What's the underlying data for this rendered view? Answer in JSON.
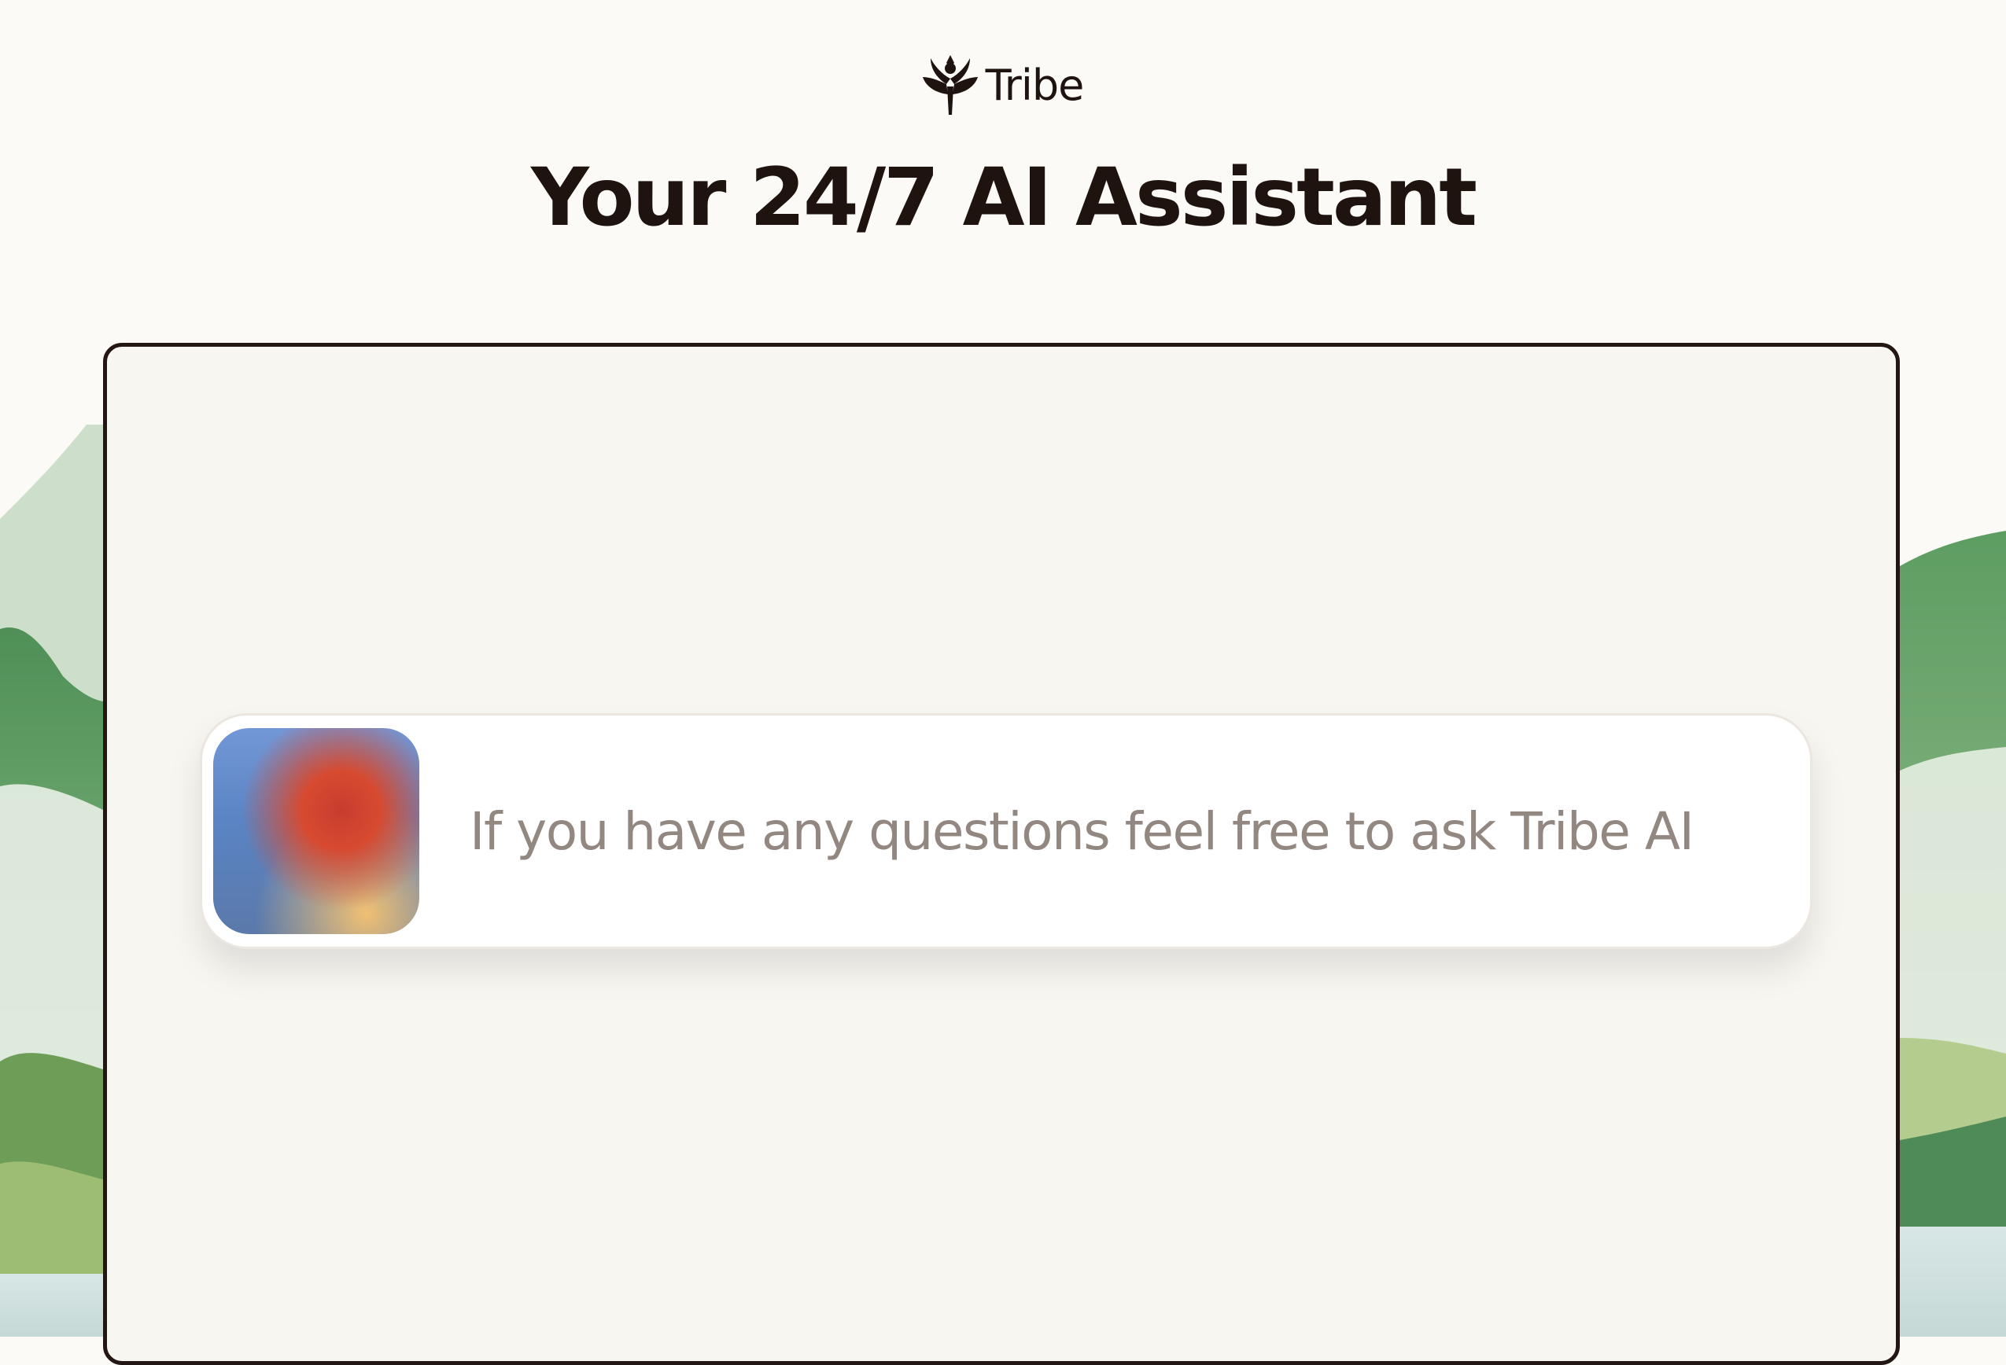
{
  "brand": {
    "logo_icon": "tribe-lotus-logo-icon",
    "name": "Tribe"
  },
  "hero": {
    "title": "Your 24/7 AI Assistant"
  },
  "chat": {
    "avatar_icon": "assistant-gradient-avatar",
    "prompt_text": "If you have any questions feel free to ask Tribe AI"
  },
  "colors": {
    "text_dark": "#1f130f",
    "panel_background": "#f8f6f1",
    "panel_border": "#241612",
    "prompt_text": "#938781",
    "landscape_green": "#5f9b62"
  }
}
